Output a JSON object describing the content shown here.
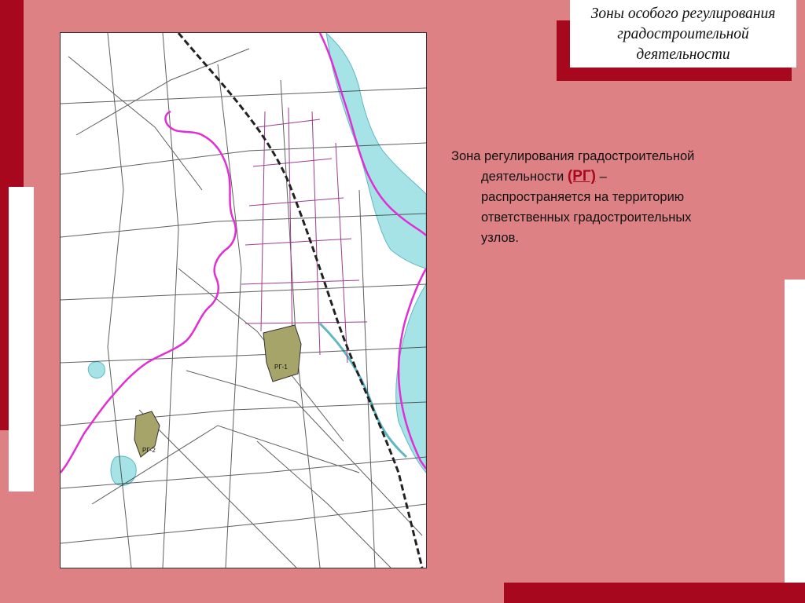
{
  "title": {
    "line1": "Зоны особого регулирования",
    "line2": "градостроительной",
    "line3": "деятельности"
  },
  "description": {
    "line1": "Зона регулирования градостроительной",
    "line2_before": "деятельности ",
    "zone_code": "(РГ)",
    "line2_after": " –",
    "line3": "распространяется на территорию",
    "line4": "ответственных градостроительных",
    "line5": "узлов."
  },
  "map": {
    "zone_labels": [
      "РГ-1",
      "РГ-2"
    ],
    "colors": {
      "river": "#a6e3e6",
      "boundary": "#e02fd2",
      "zone_fill": "#a7a46a",
      "rail": "#222222",
      "roads": "#2a2a2a",
      "district_streets": "#9b3c8e"
    }
  },
  "colors": {
    "background": "#dd8185",
    "accent_red": "#a8081e",
    "white": "#ffffff"
  }
}
